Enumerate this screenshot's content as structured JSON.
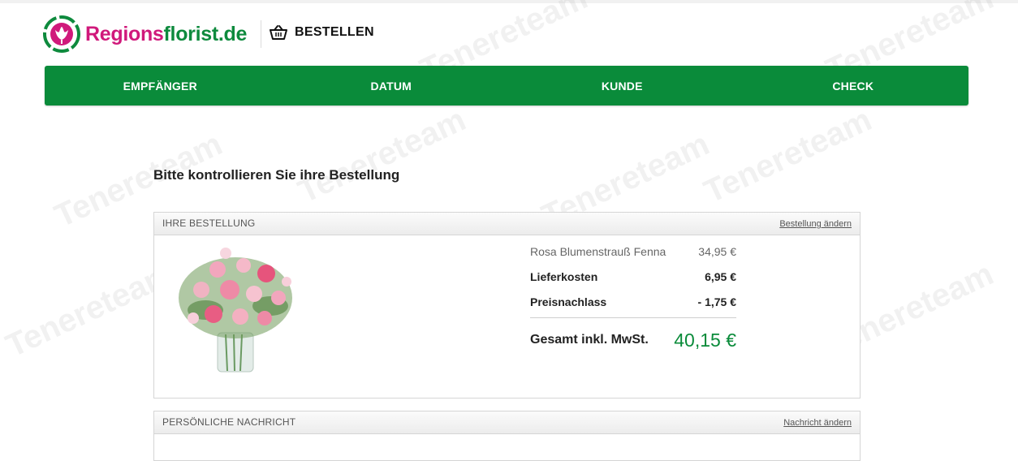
{
  "brand": {
    "name_part1": "Regions",
    "name_part2": "florist.de",
    "color_pink": "#d0197b",
    "color_green": "#0e8a3d"
  },
  "header": {
    "order_label": "BESTELLEN",
    "icon": "basket-icon"
  },
  "steps": [
    {
      "label": "EMPFÄNGER"
    },
    {
      "label": "DATUM"
    },
    {
      "label": "KUNDE"
    },
    {
      "label": "CHECK"
    }
  ],
  "page": {
    "heading": "Bitte kontrollieren Sie ihre Bestellung"
  },
  "order_panel": {
    "title": "IHRE BESTELLUNG",
    "edit_link": "Bestellung ändern",
    "image": "pink-bouquet-in-glass-vase",
    "lines": [
      {
        "label": "Rosa Blumenstrauß Fenna",
        "amount": "34,95 €"
      },
      {
        "label": "Lieferkosten",
        "amount": "6,95 €"
      },
      {
        "label": "Preisnachlass",
        "amount": "- 1,75 €"
      }
    ],
    "total_label": "Gesamt inkl. MwSt.",
    "total_amount": "40,15 €"
  },
  "message_panel": {
    "title": "PERSÖNLICHE NACHRICHT",
    "edit_link": "Nachricht ändern"
  },
  "watermark_text": "Tenereteam",
  "accent_color": "#0a8b3a"
}
